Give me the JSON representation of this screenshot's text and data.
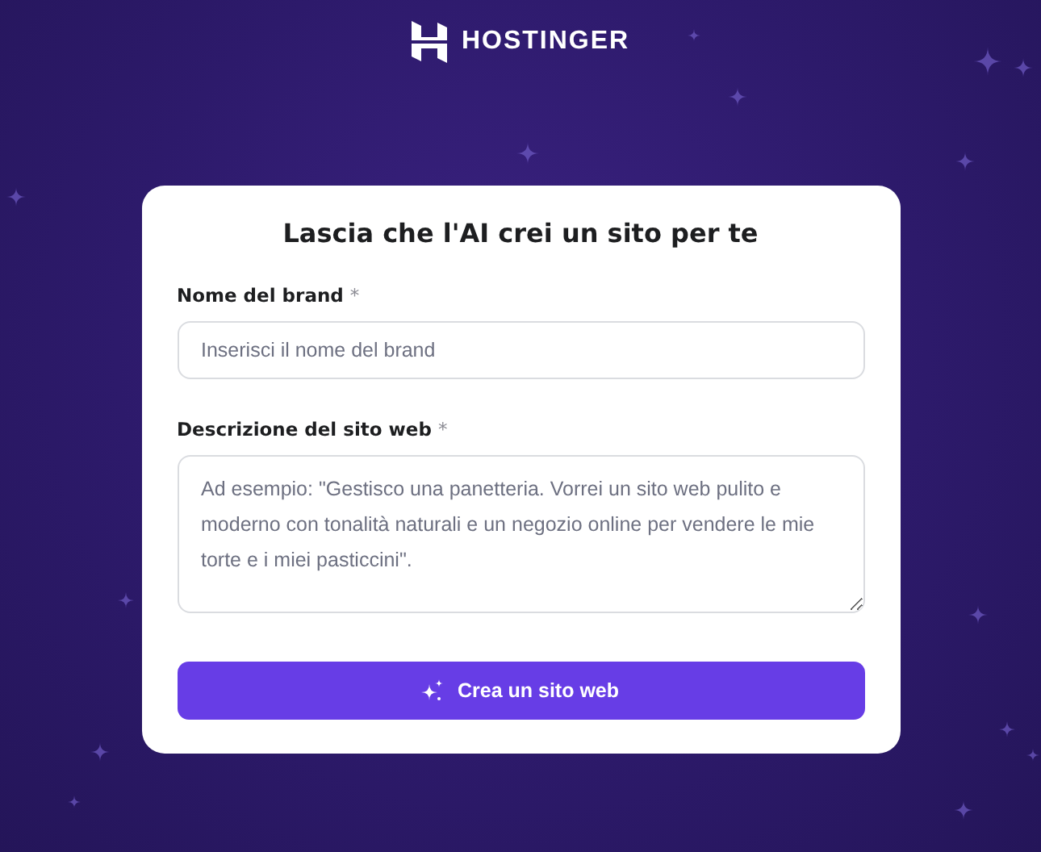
{
  "logo": {
    "text": "HOSTINGER"
  },
  "card": {
    "title": "Lascia che l'AI crei un sito per te",
    "fields": [
      {
        "kind": "input",
        "label": "Nome del brand",
        "required_mark": "*",
        "placeholder": "Inserisci il nome del brand"
      },
      {
        "kind": "textarea",
        "label": "Descrizione del sito web",
        "required_mark": "*",
        "placeholder": "Ad esempio: \"Gestisco una panetteria. Vorrei un sito web pulito e moderno con tonalità naturali e un negozio online per vendere le mie torte e i miei pasticcini\"."
      }
    ],
    "button": {
      "label": "Crea un sito web"
    }
  }
}
